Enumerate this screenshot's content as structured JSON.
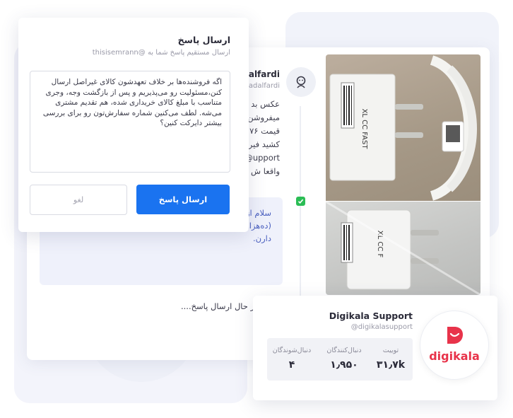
{
  "reply_dialog": {
    "title": "ارسال پاسخ",
    "subtitle": "ارسال مستقیم پاسخ شما به @thisisemrann",
    "textarea_value": "اگه فروشنده‌ها بر خلاف تعهدشون کالای غیراصل ارسال کنن،مسئولیت رو می‌پذیریم و پس از بازگشت وجه، وجری متناسب با مبلغ کالای خریداری شده، هم تقدیم مشتری می‌شه. لطف می‌کنین شماره سفارش‌تون رو برای بررسی بیشتر دایرکت کنین؟",
    "cancel_label": "لغو",
    "send_label": "ارسال پاسخ"
  },
  "tweet": {
    "name": "zadalfardi",
    "handle": "@zadalfardi",
    "lines": [
      "عکس بد",
      "میفروشن",
      "قیمت ۷۶",
      "کشید فیر",
      "upport@",
      "واقعا ش"
    ],
    "avatar_icon": "user-avatar-icon"
  },
  "reply": {
    "text": "سلام از اواسط انجام شده و در حال حاضر کمتر از نیم درصد (ده‌هزار کالا از بیش از دو میلیون تنوع کالا) نشان \"غیر اصل\" دارن.",
    "status_text": "در حال ارسال پاسخ...."
  },
  "photos": {
    "top_caption": "XL CC FAST",
    "bottom_caption": "XL CC F"
  },
  "profile": {
    "name": "Digikala Support",
    "handle": "@digikalasupport",
    "logo_text": "digikala",
    "brand_color": "#e8334a",
    "stats": [
      {
        "label": "توییت",
        "value": "۳۱٫۷k"
      },
      {
        "label": "دنبال‌کنندگان",
        "value": "۱٫۹۵۰"
      },
      {
        "label": "دنبال‌شوندگان",
        "value": "۴"
      }
    ]
  },
  "colors": {
    "accent": "#1a73f0",
    "check": "#2bbd55",
    "reply_text": "#4a5fbf"
  }
}
